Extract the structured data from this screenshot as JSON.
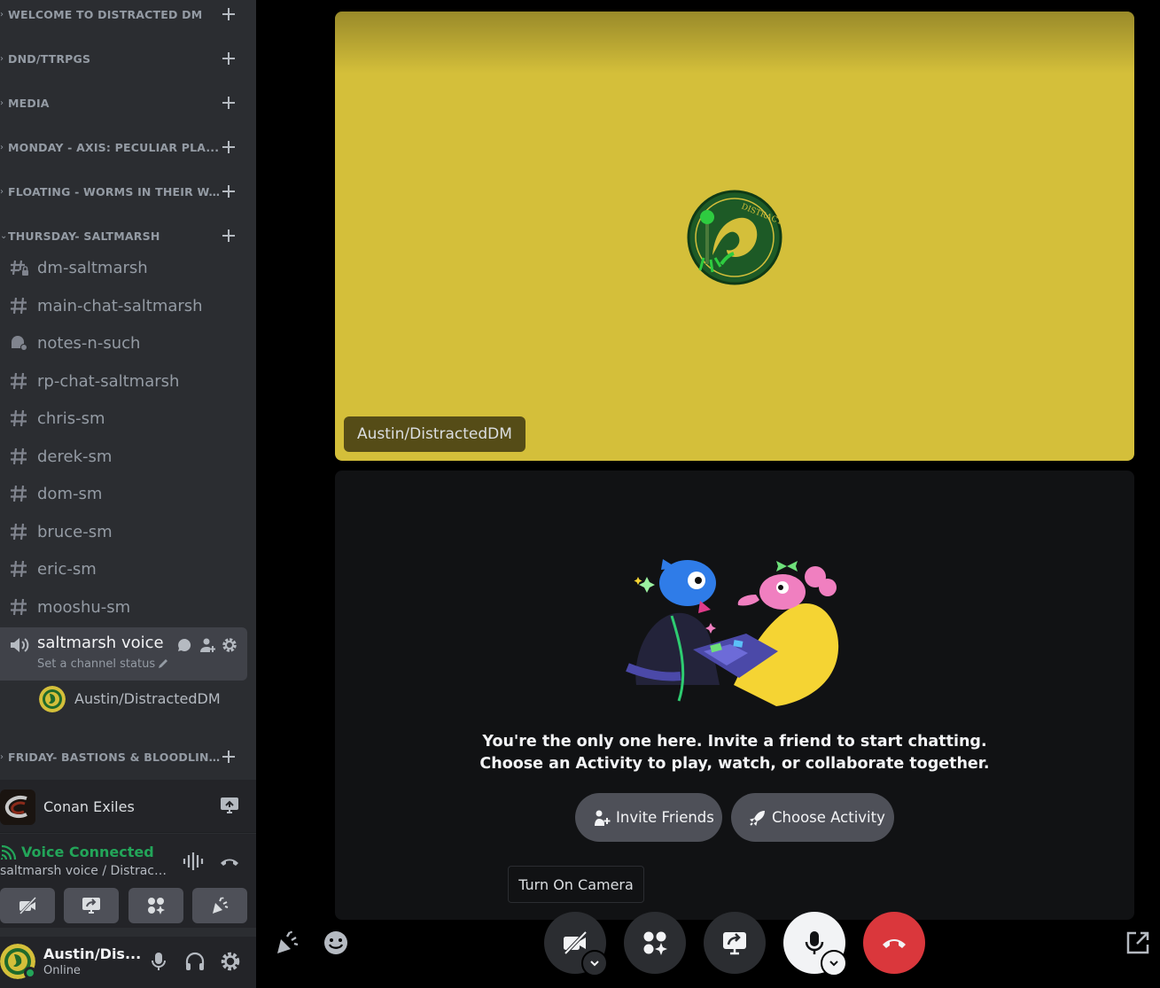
{
  "sidebar": {
    "categories": [
      {
        "label": "WELCOME TO DISTRACTED DM"
      },
      {
        "label": "DND/TTRPGS"
      },
      {
        "label": "MEDIA"
      },
      {
        "label": "MONDAY - AXIS: PECULIAR PLA..."
      },
      {
        "label": "FLOATING - WORMS IN THEIR W..."
      },
      {
        "label": "THURSDAY- SALTMARSH"
      }
    ],
    "channels": [
      {
        "label": "dm-saltmarsh",
        "icon": "hash-lock-icon"
      },
      {
        "label": "main-chat-saltmarsh",
        "icon": "hash-icon"
      },
      {
        "label": "notes-n-such",
        "icon": "forum-icon"
      },
      {
        "label": "rp-chat-saltmarsh",
        "icon": "hash-icon"
      },
      {
        "label": "chris-sm",
        "icon": "hash-icon"
      },
      {
        "label": "derek-sm",
        "icon": "hash-icon"
      },
      {
        "label": "dom-sm",
        "icon": "hash-icon"
      },
      {
        "label": "bruce-sm",
        "icon": "hash-icon"
      },
      {
        "label": "eric-sm",
        "icon": "hash-icon"
      },
      {
        "label": "mooshu-sm",
        "icon": "hash-icon"
      }
    ],
    "voice_channel": {
      "label": "saltmarsh voice",
      "status_placeholder": "Set a channel status"
    },
    "voice_user": {
      "name": "Austin/DistractedDM"
    },
    "last_category": {
      "label": "FRIDAY- BASTIONS & BLOODLIN..."
    }
  },
  "activity": {
    "game": "Conan Exiles"
  },
  "voice_panel": {
    "title": "Voice Connected",
    "subtitle": "saltmarsh voice / Distracte..."
  },
  "user_bar": {
    "name": "Austin/Dis...",
    "status": "Online"
  },
  "main": {
    "user_tile": {
      "name": "Austin/DistractedDM",
      "bg_color": "#d4bf3a",
      "logo_text": "DISTRACTED DM"
    },
    "empty_tile": {
      "line1": "You're the only one here. Invite a friend to start chatting.",
      "line2": "Choose an Activity to play, watch, or collaborate together.",
      "invite_label": "Invite Friends",
      "activity_label": "Choose Activity"
    },
    "tooltip": "Turn On Camera"
  },
  "colors": {
    "accent_green": "#23a559",
    "hangup_red": "#da373c",
    "sidebar_bg": "#2b2d31"
  }
}
